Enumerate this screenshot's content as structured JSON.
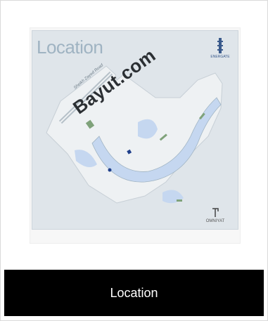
{
  "image": {
    "title": "Location",
    "road_label": "Sheikh Zayed Road",
    "watermark": "Bayut.com",
    "brand_logo": "building-logo-icon",
    "brand_text": "ENERGATE",
    "developer_text": "OMNIYAT"
  },
  "caption": {
    "text": "Location"
  },
  "colors": {
    "map_bg": "#dfe5ea",
    "water": "#c5d7f0",
    "land": "#eef1f3",
    "green": "#7fa27a",
    "caption_bg": "#000000"
  }
}
